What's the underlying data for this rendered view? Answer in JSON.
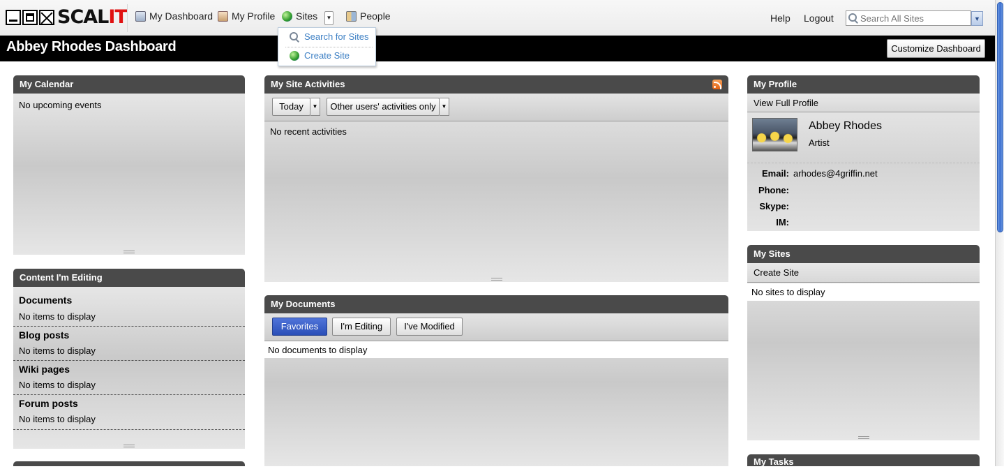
{
  "logo": {
    "word_a": "SCAL",
    "word_b": "IT"
  },
  "nav": {
    "my_dashboard": "My Dashboard",
    "my_profile": "My Profile",
    "sites": "Sites",
    "people": "People"
  },
  "sites_menu": {
    "search": "Search for Sites",
    "create": "Create Site"
  },
  "top_links": {
    "help": "Help",
    "logout": "Logout"
  },
  "search": {
    "placeholder": "Search All Sites"
  },
  "title_bar": {
    "title": "Abbey Rhodes Dashboard",
    "customize": "Customize Dashboard"
  },
  "calendar": {
    "title": "My Calendar",
    "empty": "No upcoming events"
  },
  "editing": {
    "title": "Content I'm Editing",
    "sections": [
      {
        "heading": "Documents",
        "empty": "No items to display"
      },
      {
        "heading": "Blog posts",
        "empty": "No items to display"
      },
      {
        "heading": "Wiki pages",
        "empty": "No items to display"
      },
      {
        "heading": "Forum posts",
        "empty": "No items to display"
      }
    ]
  },
  "activities": {
    "title": "My Site Activities",
    "range": "Today",
    "filter": "Other users' activities only",
    "empty": "No recent activities"
  },
  "documents": {
    "title": "My Documents",
    "tabs": [
      "Favorites",
      "I'm Editing",
      "I've Modified"
    ],
    "active_tab": "Favorites",
    "empty": "No documents to display"
  },
  "profile": {
    "title": "My Profile",
    "view_full": "View Full Profile",
    "name": "Abbey Rhodes",
    "role": "Artist",
    "fields": [
      {
        "label": "Email:",
        "value": "arhodes@4griffin.net"
      },
      {
        "label": "Phone:",
        "value": ""
      },
      {
        "label": "Skype:",
        "value": ""
      },
      {
        "label": "IM:",
        "value": ""
      }
    ]
  },
  "my_sites": {
    "title": "My Sites",
    "create": "Create Site",
    "empty": "No sites to display"
  },
  "my_tasks": {
    "title": "My Tasks"
  },
  "colors": {
    "header_bg": "#4a4a4a",
    "title_bar_bg": "#000000",
    "link": "#3c7fc4",
    "active_tab": "#2a4fb8",
    "logo_accent": "#e01010"
  }
}
